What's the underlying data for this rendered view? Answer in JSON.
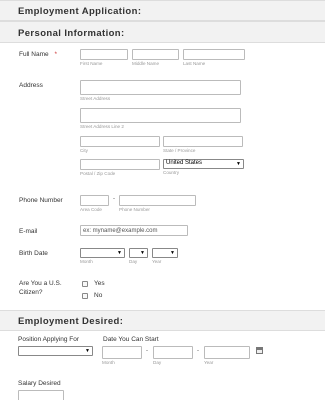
{
  "form": {
    "title": "Employment Application:",
    "section_personal": "Personal Information:",
    "section_employment": "Employment Desired:"
  },
  "full_name": {
    "label": "Full Name",
    "required_mark": "*",
    "first_sub": "First Name",
    "middle_sub": "Middle Name",
    "last_sub": "Last Name"
  },
  "address": {
    "label": "Address",
    "street_sub": "Street Address",
    "street2_sub": "Street Address Line 2",
    "city_sub": "City",
    "state_sub": "State / Province",
    "postal_sub": "Postal / Zip Code",
    "country_sub": "Country",
    "country_value": "United States"
  },
  "phone": {
    "label": "Phone Number",
    "area_sub": "Area Code",
    "number_sub": "Phone Number",
    "dash": "-"
  },
  "email": {
    "label": "E-mail",
    "placeholder": "ex: myname@example.com"
  },
  "birth": {
    "label": "Birth Date",
    "month_sub": "Month",
    "day_sub": "Day",
    "year_sub": "Year"
  },
  "citizen": {
    "label_line1": "Are You a U.S.",
    "label_line2": "Citizen?",
    "yes": "Yes",
    "no": "No"
  },
  "employment": {
    "position_label": "Position Applying For",
    "start_label": "Date You Can Start",
    "month_sub": "Month",
    "day_sub": "Day",
    "year_sub": "Year",
    "dash": "-",
    "salary_label": "Salary Desired"
  },
  "icons": {
    "calendar": "calendar-icon",
    "dropdown": "chevron-down-icon"
  }
}
